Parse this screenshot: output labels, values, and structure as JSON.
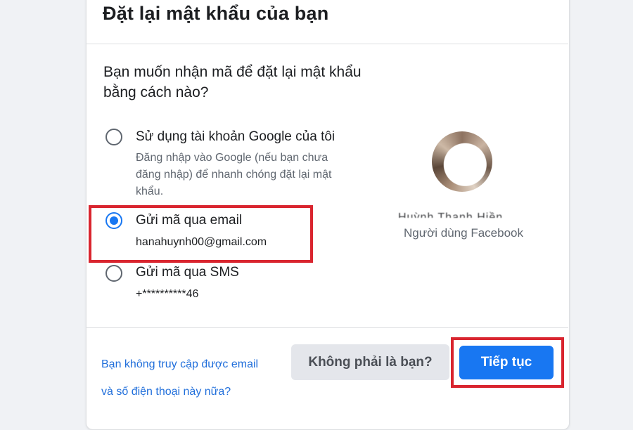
{
  "dialog": {
    "title": "Đặt lại mật khẩu của bạn",
    "question": "Bạn muốn nhận mã để đặt lại mật khẩu bằng cách nào?"
  },
  "options": [
    {
      "label": "Sử dụng tài khoản Google của tôi",
      "description_lines": [
        "Đăng nhập vào Google (nếu bạn chưa",
        "đăng nhập) để nhanh chóng đặt lại mật",
        "khẩu."
      ],
      "selected": false
    },
    {
      "label": "Gửi mã qua email",
      "detail": "hanahuynh00@gmail.com",
      "selected": true
    },
    {
      "label": "Gửi mã qua SMS",
      "detail": "+**********46",
      "selected": false
    }
  ],
  "profile": {
    "name": "Huỳnh Thanh Hiền",
    "role": "Người dùng Facebook"
  },
  "footer": {
    "link_line1": "Bạn không truy cập được email",
    "link_line2": "và số điện thoại này nữa?",
    "secondary_button": "Không phải là bạn?",
    "primary_button": "Tiếp tục"
  },
  "colors": {
    "accent": "#1877f2",
    "highlight": "#d9252f",
    "link": "#216fdb"
  }
}
